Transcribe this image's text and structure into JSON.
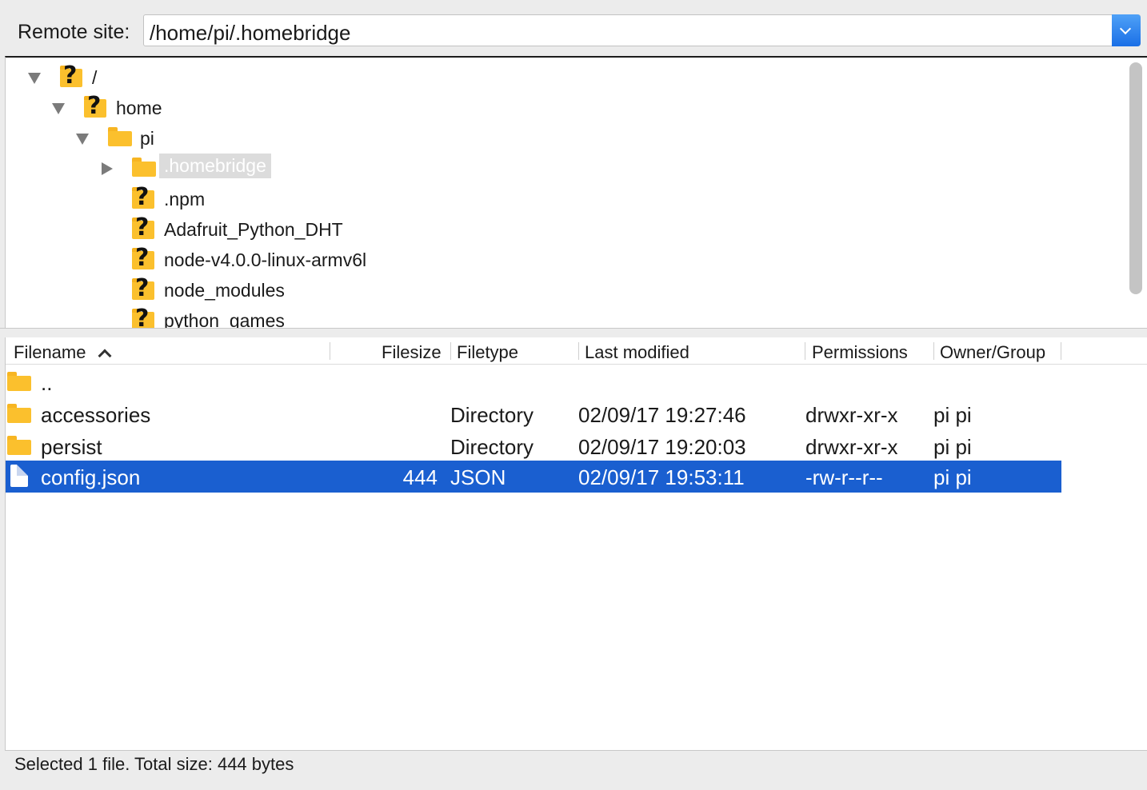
{
  "remote_site": {
    "label": "Remote site:",
    "path": "/home/pi/.homebridge"
  },
  "tree": [
    {
      "label": "/",
      "icon": "unknown-folder-icon",
      "expander": "expanded"
    },
    {
      "label": "home",
      "icon": "unknown-folder-icon",
      "expander": "expanded"
    },
    {
      "label": "pi",
      "icon": "folder-icon",
      "expander": "expanded"
    },
    {
      "label": ".homebridge",
      "icon": "folder-icon",
      "expander": "collapsed",
      "selected": true
    },
    {
      "label": ".npm",
      "icon": "unknown-folder-icon"
    },
    {
      "label": "Adafruit_Python_DHT",
      "icon": "unknown-folder-icon"
    },
    {
      "label": "node-v4.0.0-linux-armv6l",
      "icon": "unknown-folder-icon"
    },
    {
      "label": "node_modules",
      "icon": "unknown-folder-icon"
    },
    {
      "label": "python_games",
      "icon": "unknown-folder-icon"
    }
  ],
  "columns": {
    "filename": "Filename",
    "filesize": "Filesize",
    "filetype": "Filetype",
    "last_modified": "Last modified",
    "permissions": "Permissions",
    "owner_group": "Owner/Group"
  },
  "files": [
    {
      "name": "..",
      "size": "",
      "type": "",
      "modified": "",
      "permissions": "",
      "owner": "",
      "icon": "folder-icon"
    },
    {
      "name": "accessories",
      "size": "",
      "type": "Directory",
      "modified": "02/09/17 19:27:46",
      "permissions": "drwxr-xr-x",
      "owner": "pi pi",
      "icon": "folder-icon"
    },
    {
      "name": "persist",
      "size": "",
      "type": "Directory",
      "modified": "02/09/17 19:20:03",
      "permissions": "drwxr-xr-x",
      "owner": "pi pi",
      "icon": "folder-icon"
    },
    {
      "name": "config.json",
      "size": "444",
      "type": "JSON",
      "modified": "02/09/17 19:53:11",
      "permissions": "-rw-r--r--",
      "owner": "pi pi",
      "icon": "file-icon",
      "selected": true
    }
  ],
  "status": "Selected 1 file. Total size: 444 bytes",
  "colors": {
    "selection": "#1a5fd0",
    "folder": "#fbc02d",
    "accent": "#1a6fe6"
  }
}
